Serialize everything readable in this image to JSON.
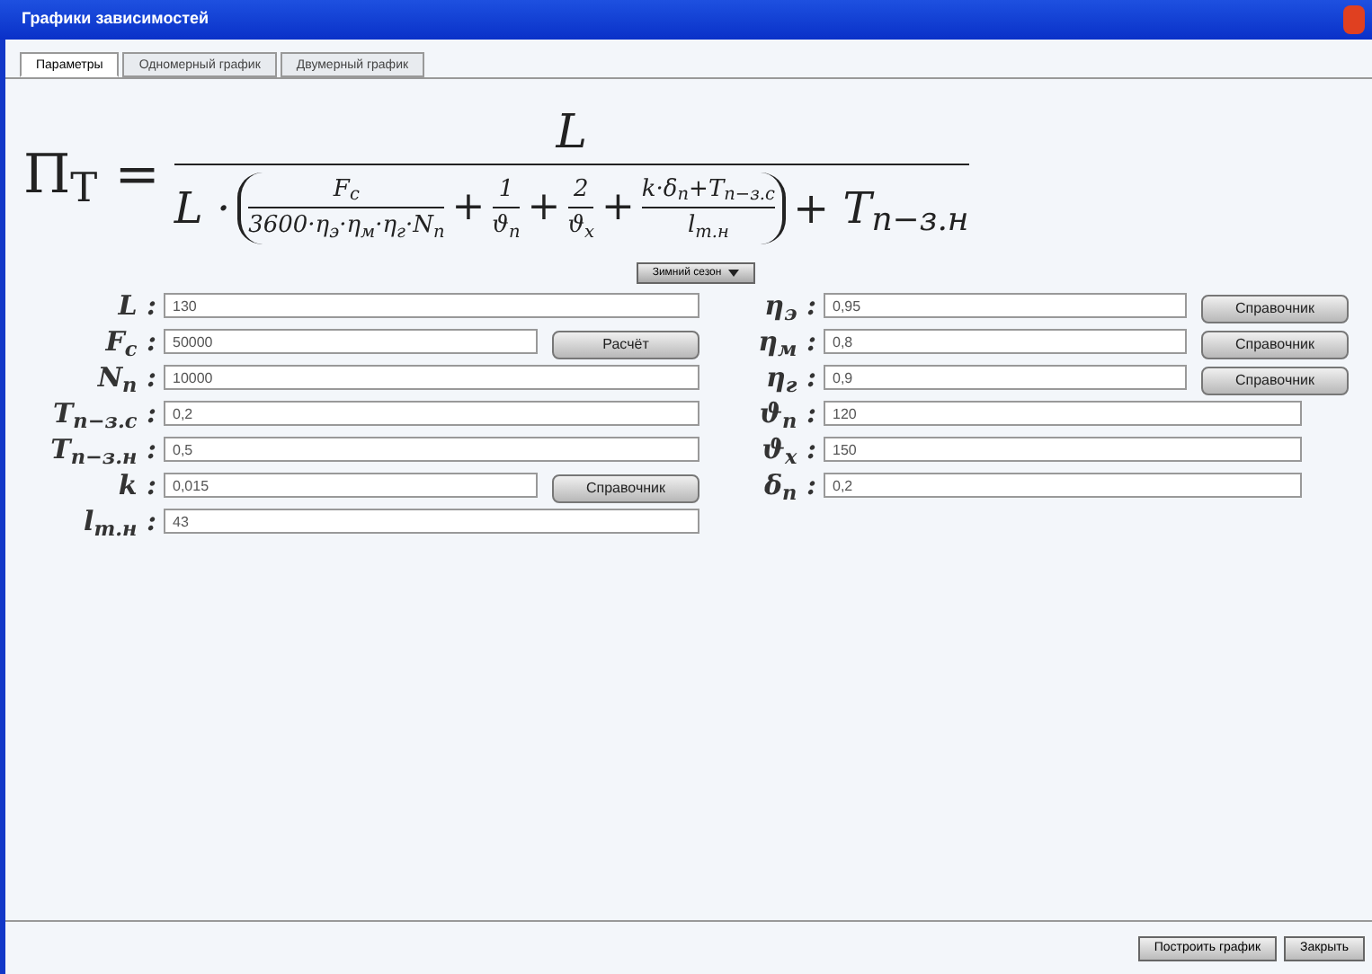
{
  "window": {
    "title": "Графики зависимостей"
  },
  "tabs": [
    {
      "label": "Параметры",
      "selected": true
    },
    {
      "label": "Одномерный график",
      "selected": false
    },
    {
      "label": "Двумерный график",
      "selected": false
    }
  ],
  "formula": {
    "lhs": "Π$_{T}$ =",
    "numerator": "L",
    "lead": "L ·",
    "terms": [
      {
        "num": "F$_{c}$",
        "den": "3600·η$_{э}$·η$_{м}$·η$_{г}$·N$_{п}$"
      },
      {
        "op": "+",
        "num": "1",
        "den": "ϑ$_{п}$"
      },
      {
        "op": "+",
        "num": "2",
        "den": "ϑ$_{х}$"
      },
      {
        "op": "+",
        "num": "k·δ$_{п}$+T$_{п−з.с}$",
        "den": "l$_{т.н}$"
      }
    ],
    "tail": "+ T$_{п−з.н}$"
  },
  "season_dropdown": {
    "value": "Зимний сезон"
  },
  "left_fields": [
    {
      "label": "L :",
      "value": "130"
    },
    {
      "label": "F$_{c}$ :",
      "value": "50000",
      "button": "Расчёт"
    },
    {
      "label": "N$_{п}$ :",
      "value": "10000"
    },
    {
      "label": "T$_{п−з.с}$ :",
      "value": "0,2"
    },
    {
      "label": "T$_{п−з.н}$ :",
      "value": "0,5"
    },
    {
      "label": "k :",
      "value": "0,015",
      "button": "Справочник"
    },
    {
      "label": "l$_{т.н}$ :",
      "value": "43"
    }
  ],
  "right_fields": [
    {
      "label": "η$_{э}$ :",
      "value": "0,95",
      "button": "Справочник"
    },
    {
      "label": "η$_{м}$ :",
      "value": "0,8",
      "button": "Справочник"
    },
    {
      "label": "η$_{г}$ :",
      "value": "0,9",
      "button": "Справочник"
    },
    {
      "label": "ϑ$_{п}$ :",
      "value": "120"
    },
    {
      "label": "ϑ$_{х}$ :",
      "value": "150"
    },
    {
      "label": "δ$_{п}$ :",
      "value": "0,2"
    }
  ],
  "footer_buttons": [
    "Построить график",
    "Закрыть"
  ]
}
